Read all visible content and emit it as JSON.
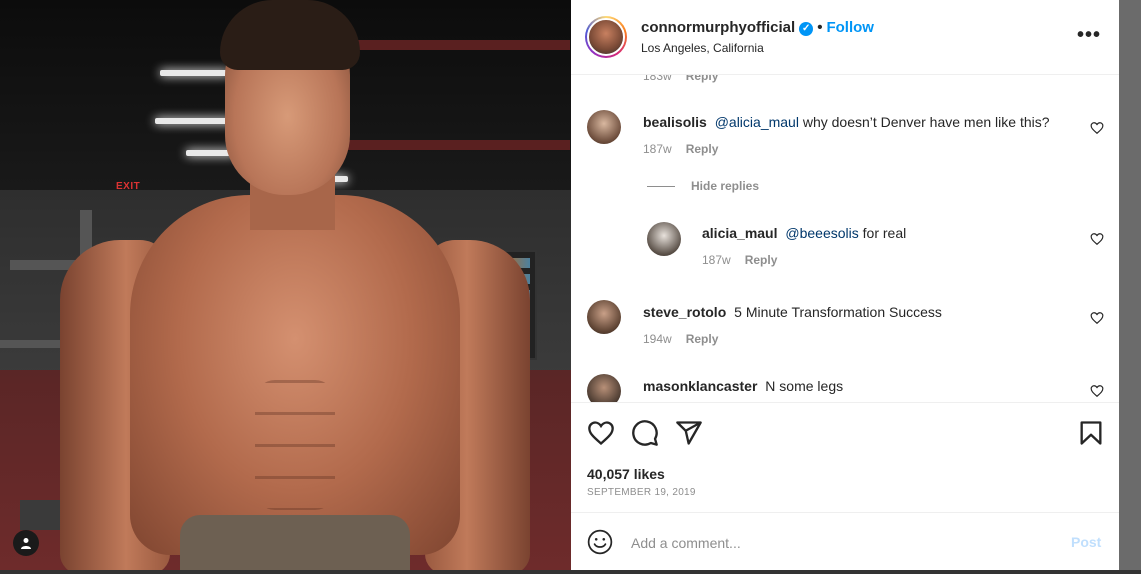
{
  "header": {
    "username": "connormurphyofficial",
    "verified_mark": "✓",
    "separator": "•",
    "follow_label": "Follow",
    "location": "Los Angeles, California",
    "more_label": "•••"
  },
  "clipped_row": {
    "time": "183w",
    "reply": "Reply"
  },
  "comments": [
    {
      "username": "bealisolis",
      "mention": "@alicia_maul",
      "text": "why doesn’t Denver have men like this?",
      "time": "187w",
      "reply": "Reply"
    },
    {
      "username": "alicia_maul",
      "mention": "@beeesolis",
      "text": "for real",
      "time": "187w",
      "reply": "Reply"
    },
    {
      "username": "steve_rotolo",
      "mention": "",
      "text": "5 Minute Transformation Success",
      "time": "194w",
      "reply": "Reply"
    },
    {
      "username": "masonklancaster",
      "mention": "",
      "text": "N some legs",
      "time": "",
      "reply": ""
    }
  ],
  "hide_replies_label": "Hide replies",
  "likes": "40,057 likes",
  "date": "SEPTEMBER 19, 2019",
  "comment_input": {
    "placeholder": "Add a comment...",
    "post_label": "Post"
  },
  "photo": {
    "exit_sign": "EXIT"
  },
  "icons": {
    "heart": "heart-icon",
    "comment": "comment-icon",
    "share": "share-icon",
    "bookmark": "bookmark-icon",
    "emoji": "emoji-icon",
    "user": "user-icon"
  },
  "colors": {
    "follow": "#0095f6",
    "text": "#262626",
    "muted": "#8e8e8e",
    "mention": "#00376b",
    "post_disabled": "#c0dffd"
  }
}
